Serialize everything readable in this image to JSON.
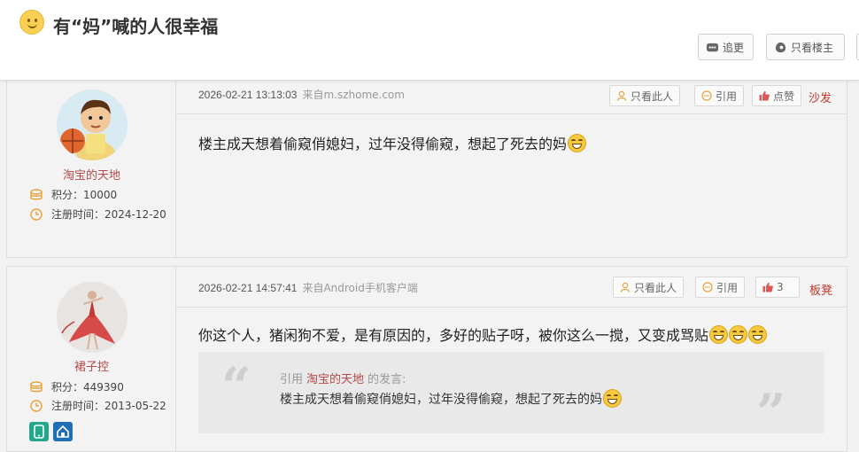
{
  "header": {
    "title": "有“妈”喊的人很幸福",
    "follow_label": "追更",
    "only_op_label": "只看楼主"
  },
  "posts": [
    {
      "author": {
        "name": "淘宝的天地",
        "points_label": "积分：",
        "points": "10000",
        "reg_label": "注册时间：",
        "reg_date": "2024-12-20"
      },
      "time": "2026-02-21 13:13:03",
      "source": "来自m.szhome.com",
      "buttons": {
        "only_this": "只看此人",
        "quote": "引用",
        "like": "点赞"
      },
      "floor": "沙发",
      "text": "楼主成天想着偷窥俏媳妇，过年没得偷窥，想起了死去的妈"
    },
    {
      "author": {
        "name": "裙子控",
        "points_label": "积分：",
        "points": "449390",
        "reg_label": "注册时间：",
        "reg_date": "2013-05-22"
      },
      "time": "2026-02-21 14:57:41",
      "source": "来自Android手机客户端",
      "buttons": {
        "only_this": "只看此人",
        "quote": "引用",
        "like": "3"
      },
      "floor": "板凳",
      "text": "你这个人，猪闲狗不爱，是有原因的，多好的贴子呀，被你这么一搅，又变成骂贴",
      "quote": {
        "prefix": "引用",
        "name": "淘宝的天地",
        "suffix": "的发言:",
        "text": "楼主成天想着偷窥俏媳妇，过年没得偷窥，想起了死去的妈"
      }
    }
  ],
  "colors": {
    "accent_red": "#c0392b",
    "name_red": "#b5494a",
    "icon_orange": "#e8a13a",
    "like_red": "#e05555"
  },
  "icons": [
    "smiley-icon",
    "comment-icon",
    "eye-icon",
    "user-icon",
    "quote-icon",
    "thumb-up-icon",
    "coins-icon",
    "clock-icon",
    "mobile-badge-icon",
    "home-badge-icon",
    "grin-emoji-icon"
  ]
}
